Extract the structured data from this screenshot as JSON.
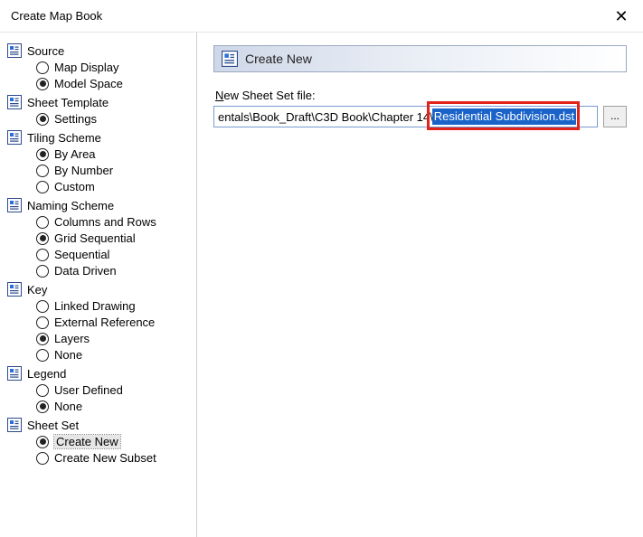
{
  "window": {
    "title": "Create Map Book",
    "close_glyph": "✕"
  },
  "sidebar": {
    "groups": [
      {
        "label": "Source",
        "items": [
          {
            "label": "Map Display",
            "selected": false
          },
          {
            "label": "Model Space",
            "selected": true
          }
        ]
      },
      {
        "label": "Sheet Template",
        "items": [
          {
            "label": "Settings",
            "selected": true
          }
        ]
      },
      {
        "label": "Tiling Scheme",
        "items": [
          {
            "label": "By Area",
            "selected": true
          },
          {
            "label": "By Number",
            "selected": false
          },
          {
            "label": "Custom",
            "selected": false
          }
        ]
      },
      {
        "label": "Naming Scheme",
        "items": [
          {
            "label": "Columns and Rows",
            "selected": false
          },
          {
            "label": "Grid Sequential",
            "selected": true
          },
          {
            "label": "Sequential",
            "selected": false
          },
          {
            "label": "Data Driven",
            "selected": false
          }
        ]
      },
      {
        "label": "Key",
        "items": [
          {
            "label": "Linked Drawing",
            "selected": false
          },
          {
            "label": "External Reference",
            "selected": false
          },
          {
            "label": "Layers",
            "selected": true
          },
          {
            "label": "None",
            "selected": false
          }
        ]
      },
      {
        "label": "Legend",
        "items": [
          {
            "label": "User Defined",
            "selected": false
          },
          {
            "label": "None",
            "selected": true
          }
        ]
      },
      {
        "label": "Sheet Set",
        "items": [
          {
            "label": "Create New",
            "selected": true,
            "active": true
          },
          {
            "label": "Create New Subset",
            "selected": false
          }
        ]
      }
    ]
  },
  "panel": {
    "title": "Create New",
    "field_label_prefix": "N",
    "field_label_rest": "ew Sheet Set file:",
    "path_visible_prefix": "entals\\Book_Draft\\C3D Book\\Chapter 14\\",
    "path_selected": "Residential Subdivision.dst",
    "full_value": "entals\\Book_Draft\\C3D Book\\Chapter 14\\Residential Subdivision.dst",
    "browse_label": "..."
  }
}
